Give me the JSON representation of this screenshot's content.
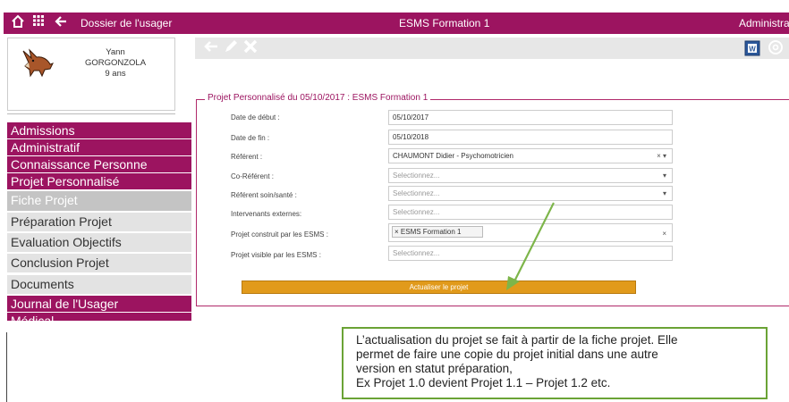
{
  "topbar": {
    "home_icon": "home-icon",
    "grid_icon": "grid-icon",
    "back_icon": "arrow-left-icon",
    "section": "Dossier de l'usager",
    "establishment": "ESMS Formation 1",
    "right": "Administrat"
  },
  "patient": {
    "avatar_icon": "fox-avatar",
    "first_name": "Yann",
    "last_name": "GORGONZOLA",
    "age": "9 ans"
  },
  "menu": [
    {
      "label": "Admissions",
      "kind": "main"
    },
    {
      "label": "Administratif",
      "kind": "main"
    },
    {
      "label": "Connaissance Personne",
      "kind": "main"
    },
    {
      "label": "Projet Personnalisé",
      "kind": "main"
    },
    {
      "label": "Fiche Projet",
      "kind": "active"
    },
    {
      "label": "Préparation Projet",
      "kind": "sub"
    },
    {
      "label": "Evaluation Objectifs",
      "kind": "sub"
    },
    {
      "label": "Conclusion Projet",
      "kind": "sub"
    },
    {
      "label": "Documents",
      "kind": "sub"
    },
    {
      "label": "Journal de l'Usager",
      "kind": "main"
    },
    {
      "label": "Médical",
      "kind": "main"
    }
  ],
  "toolbar": {
    "back_icon": "arrow-left-icon",
    "edit_icon": "pencil-icon",
    "delete_icon": "close-icon",
    "word_icon": "word-icon",
    "mail_icon": "at-icon"
  },
  "form": {
    "legend": "Projet Personnalisé du 05/10/2017 : ESMS Formation 1",
    "fields": [
      {
        "label": "Date de début :",
        "value": "05/10/2017",
        "placeholder": false,
        "control": ""
      },
      {
        "label": "Date de fin :",
        "value": "05/10/2018",
        "placeholder": false,
        "control": ""
      },
      {
        "label": "Référent :",
        "value": "CHAUMONT Didier - Psychomotricien",
        "placeholder": false,
        "control": "× ▾"
      },
      {
        "label": "Co-Référent :",
        "value": "Selectionnez...",
        "placeholder": true,
        "control": "▾"
      },
      {
        "label": "Référent soin/santé :",
        "value": "Selectionnez...",
        "placeholder": true,
        "control": "▾"
      },
      {
        "label": "Intervenants externes:",
        "value": "Selectionnez...",
        "placeholder": true,
        "control": ""
      },
      {
        "label": "Projet construit par les ESMS :",
        "value": "",
        "placeholder": false,
        "control": "×",
        "tag": "× ESMS Formation 1"
      },
      {
        "label": "Projet visible par les ESMS :",
        "value": "Selectionnez...",
        "placeholder": true,
        "control": ""
      }
    ],
    "button": "Actualiser le projet"
  },
  "note": {
    "lines": [
      "L’actualisation du projet se fait à partir de la fiche projet. Elle",
      "permet de faire une copie du projet initial dans une autre",
      "version en statut préparation,",
      "Ex Projet 1.0 devient Projet 1.1 – Projet 1.2 etc."
    ]
  },
  "colors": {
    "brand": "#9c1460",
    "button": "#e19a1b",
    "arrow": "#7db54a",
    "note_border": "#6aa335"
  }
}
